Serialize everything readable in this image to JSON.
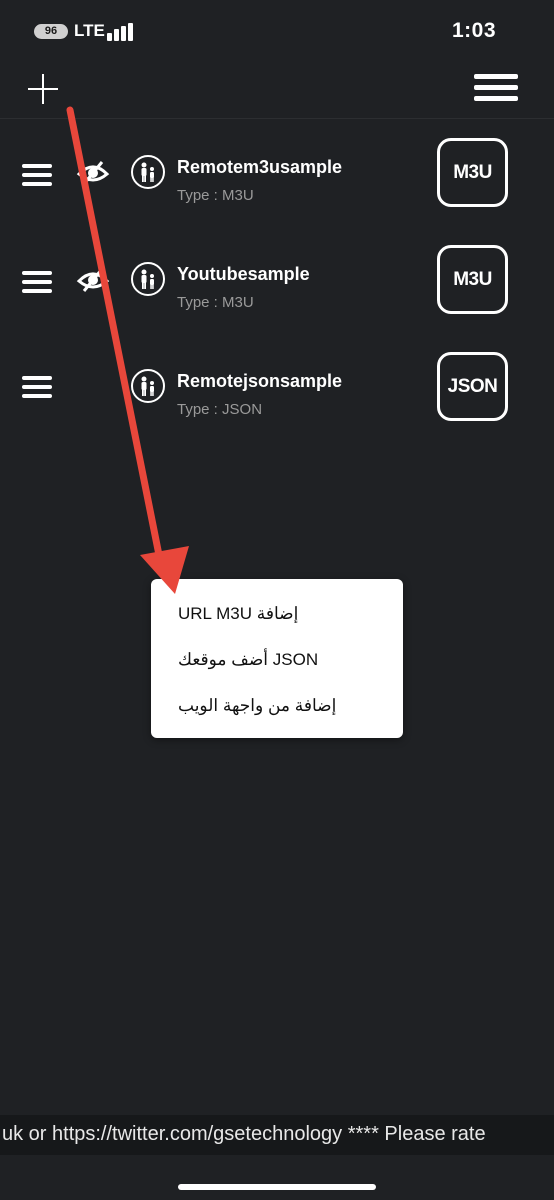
{
  "status_bar": {
    "battery_level": "96",
    "carrier": "LTE",
    "time": "1:03"
  },
  "toolbar": {
    "add_icon": "plus-icon",
    "menu_icon": "hamburger-menu-icon"
  },
  "playlists": [
    {
      "title": "Remotem3usample",
      "type_label": "Type : M3U",
      "badge": "M3U",
      "visible_icon": true
    },
    {
      "title": "Youtubesample",
      "type_label": "Type : M3U",
      "badge": "M3U",
      "visible_icon": true
    },
    {
      "title": "Remotejsonsample",
      "type_label": "Type : JSON",
      "badge": "JSON",
      "visible_icon": false
    }
  ],
  "popup_menu": {
    "items": [
      "URL M3U إضافة",
      "أضف موقعك JSON",
      "إضافة من واجهة الويب"
    ]
  },
  "ticker": {
    "text": "uk   or  https://twitter.com/gsetechnology    **** Please rate"
  },
  "colors": {
    "background": "#1f2124",
    "accent_arrow": "#e8473b",
    "popup_bg": "#ffffff"
  }
}
